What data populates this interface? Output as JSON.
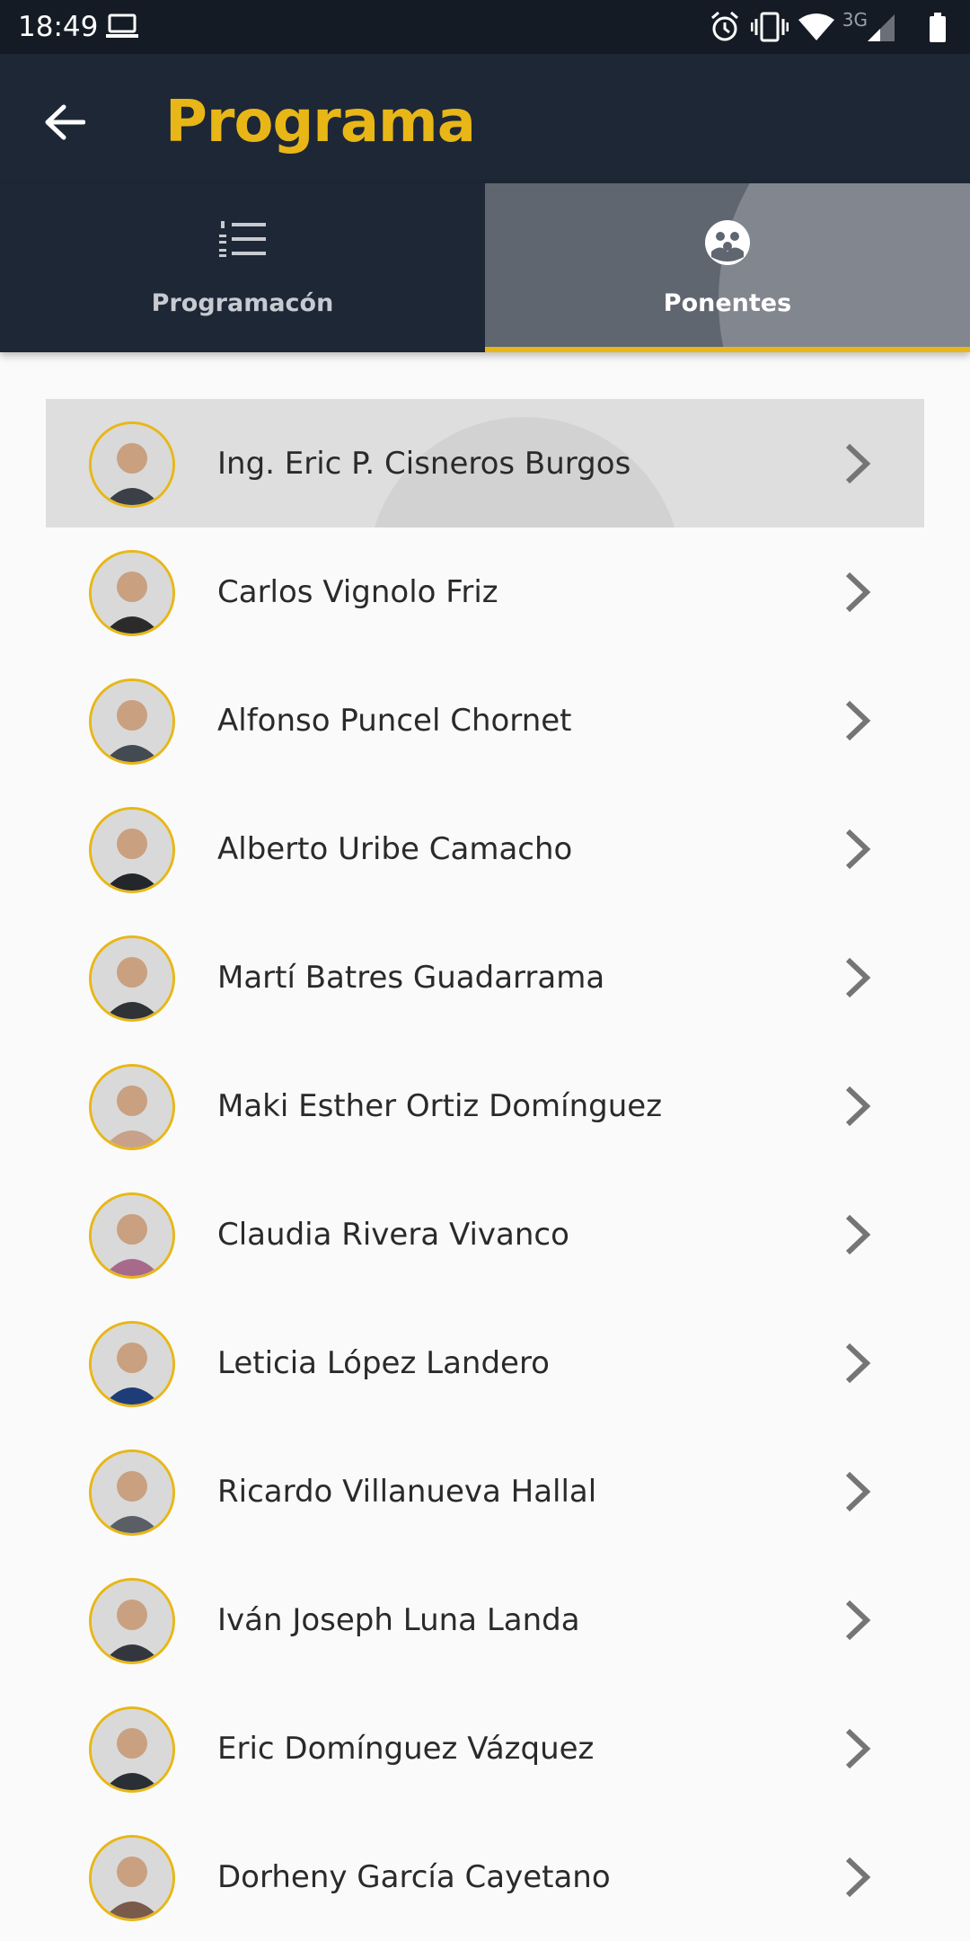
{
  "status_bar": {
    "time": "18:49",
    "network": "3G"
  },
  "app_bar": {
    "title": "Programa"
  },
  "tabs": [
    {
      "label": "Programacón",
      "icon": "numbered-list-icon",
      "selected": false
    },
    {
      "label": "Ponentes",
      "icon": "group-icon",
      "selected": true
    }
  ],
  "speakers": [
    {
      "name": "Ing. Eric P. Cisneros Burgos",
      "pressed": true
    },
    {
      "name": "Carlos Vignolo Friz"
    },
    {
      "name": "Alfonso Puncel Chornet"
    },
    {
      "name": "Alberto Uribe Camacho"
    },
    {
      "name": "Martí Batres Guadarrama"
    },
    {
      "name": "Maki Esther Ortiz Domínguez"
    },
    {
      "name": "Claudia Rivera Vivanco"
    },
    {
      "name": "Leticia López Landero"
    },
    {
      "name": "Ricardo Villanueva Hallal"
    },
    {
      "name": "Iván Joseph Luna Landa"
    },
    {
      "name": "Eric Domínguez Vázquez"
    },
    {
      "name": "Dorheny García Cayetano"
    }
  ],
  "colors": {
    "accent": "#e8b717",
    "app_bar": "#1e2735",
    "status_bar": "#151b24",
    "selected_tab": "#5f6670"
  }
}
